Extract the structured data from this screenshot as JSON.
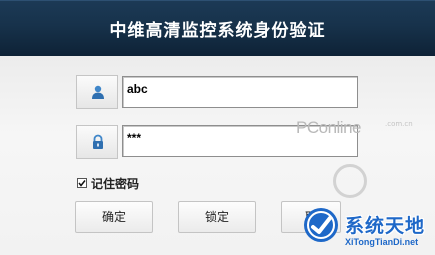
{
  "window": {
    "title": "中维高清监控系统身份验证"
  },
  "login": {
    "username_value": "abc",
    "password_value": "***",
    "username_icon": "user-icon",
    "password_icon": "lock-icon",
    "remember_label": "记住密码",
    "remember_checked": true
  },
  "buttons": {
    "confirm_label": "确定",
    "lock_label": "锁定",
    "cancel_label": "取"
  },
  "watermark": {
    "pconline": "PConline",
    "pconline_suffix": ".com.cn",
    "site_title": "系统天地",
    "site_url": "XiTongTianDi.net"
  },
  "colors": {
    "titlebar": "#17324b",
    "form_background": "#f2f2f2",
    "logo_blue": "#1e68c8"
  }
}
